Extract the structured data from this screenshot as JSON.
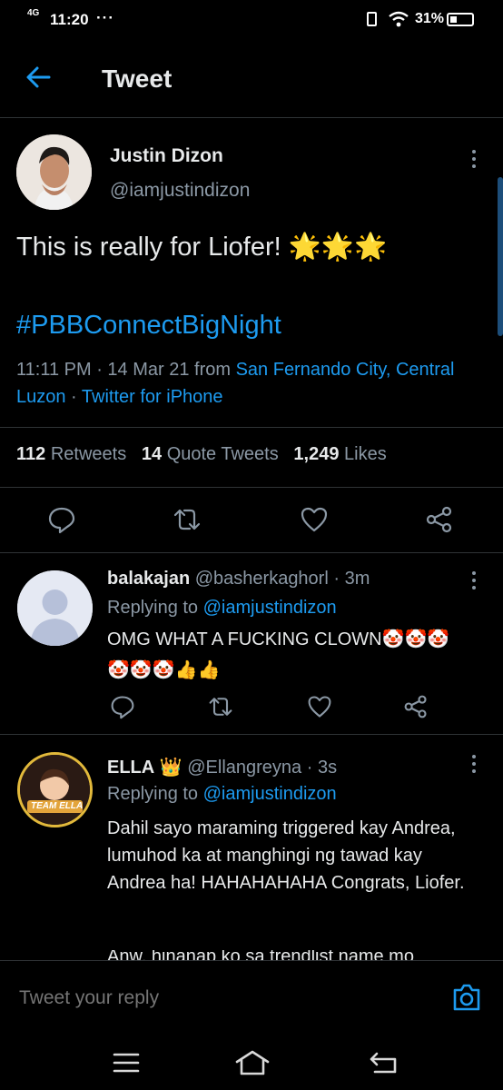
{
  "status_bar": {
    "network": "4G",
    "time": "11:20",
    "battery": "31%"
  },
  "header": {
    "title": "Tweet"
  },
  "main_tweet": {
    "name": "Justin Dizon",
    "handle": "@iamjustindizon",
    "text": "This is really for Liofer! 🌟🌟🌟",
    "hashtag": "#PBBConnectBigNight",
    "timestamp": "11:11 PM · 14 Mar 21 from ",
    "location": "San Fernando City, Central Luzon",
    "sep": " · ",
    "source": "Twitter for iPhone",
    "retweets": "112",
    "retweets_label": "Retweets",
    "quotes": "14",
    "quotes_label": "Quote Tweets",
    "likes": "1,249",
    "likes_label": "Likes"
  },
  "replies": [
    {
      "name": "balakajan",
      "handle": "@basherkaghorl",
      "time": "· 3m",
      "replying_label": "Replying to",
      "replying_to": "@iamjustindizon",
      "text_line1": "OMG WHAT A FUCKING CLOWN🤡🤡🤡",
      "text_line2": "🤡🤡🤡👍👍"
    },
    {
      "name": "ELLA",
      "crown": "👑",
      "handle": "@Ellangreyna",
      "time": "· 3s",
      "replying_label": "Replying to",
      "replying_to": "@iamjustindizon",
      "text": "Dahil sayo maraming triggered kay Andrea, lumuhod ka at manghingi ng tawad kay Andrea ha! HAHAHAHAHA Congrats, Liofer.",
      "text_cut": "Anw, hinanap ko sa trendlist name mo",
      "avatar_label": "TEAM ELLA"
    }
  ],
  "reply_bar": {
    "placeholder": "Tweet your reply"
  },
  "colors": {
    "accent": "#1d9bf0",
    "background": "#000000",
    "muted": "#8b98a5",
    "divider": "#2f3336"
  },
  "icons": [
    "back-arrow-icon",
    "kebab-icon",
    "reply-icon",
    "retweet-icon",
    "like-icon",
    "share-icon",
    "camera-icon",
    "menu-icon",
    "home-icon",
    "back-icon"
  ]
}
